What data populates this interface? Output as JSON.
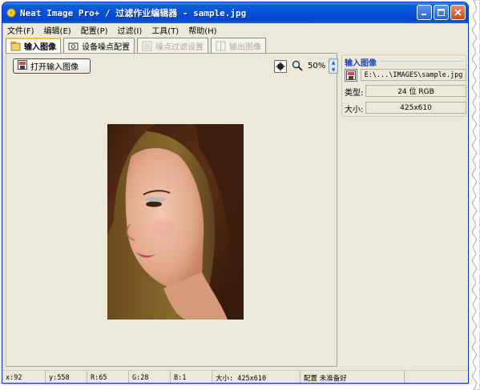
{
  "window": {
    "title": "Neat Image Pro+ / 过滤作业编辑器 - sample.jpg",
    "controls": [
      "minimize",
      "maximize",
      "close"
    ]
  },
  "menu": {
    "items": [
      "文件(F)",
      "编辑(E)",
      "配置(P)",
      "过滤(I)",
      "工具(T)",
      "帮助(H)"
    ]
  },
  "tabs": [
    {
      "label": "输入图像",
      "state": "active"
    },
    {
      "label": "设备噪点配置",
      "state": "normal"
    },
    {
      "label": "噪点过滤设置",
      "state": "disabled"
    },
    {
      "label": "输出图像",
      "state": "disabled"
    }
  ],
  "toolbar": {
    "open_label": "打开输入图像",
    "zoom_label": "50%"
  },
  "image_panel": {
    "section_title": "输入图像",
    "path": "E:\\...\\IMAGES\\sample.jpg",
    "type_label": "类型:",
    "type_value": "24 位 RGB",
    "size_label": "大小:",
    "size_value": "425x610"
  },
  "statusbar": {
    "x": "x:92",
    "y": "y:558",
    "r": "R:65",
    "g": "G:28",
    "b": "B:1",
    "size": "大小:  425x610",
    "config": "配置  未准备好"
  },
  "colors": {
    "titlebar": "#0552d8",
    "window_bg": "#ece9d8",
    "section_title": "#1c46b0",
    "active_tab_accent": "#f0c236"
  }
}
